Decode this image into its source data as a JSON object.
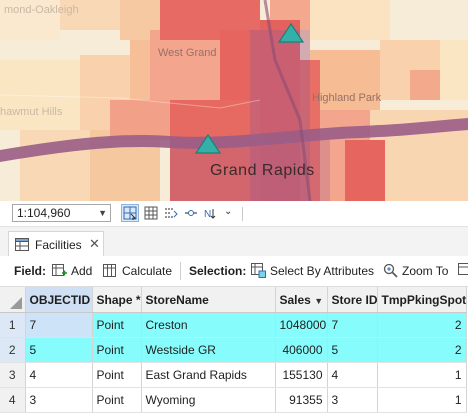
{
  "map": {
    "labels": {
      "top_left": "mond-Oakleigh",
      "west_grand": "West Grand",
      "highland_park": "Highland Park",
      "shawmut_hills": "hawmut Hills",
      "city": "Grand Rapids"
    },
    "scale": "1:104,960",
    "colors": {
      "dark": "#e86a64",
      "mid": "#f3a58d",
      "light": "#f9d2ad",
      "pale": "#fbe6c4",
      "point": "#33b0a8"
    }
  },
  "tab": {
    "label": "Facilities"
  },
  "ribbon": {
    "field_label": "Field:",
    "add": "Add",
    "calculate": "Calculate",
    "selection_label": "Selection:",
    "select_by_attributes": "Select By Attributes",
    "zoom_to": "Zoom To"
  },
  "table": {
    "columns": [
      "OBJECTID *",
      "Shape *",
      "StoreName",
      "Sales",
      "Store ID",
      "TmpPkingSpots"
    ],
    "rows": [
      {
        "num": "1",
        "objectid": "7",
        "shape": "Point",
        "store": "Creston",
        "sales": "1048000",
        "store_id": "7",
        "spots": "2",
        "selected": true
      },
      {
        "num": "2",
        "objectid": "5",
        "shape": "Point",
        "store": "Westside GR",
        "sales": "406000",
        "store_id": "5",
        "spots": "2",
        "selected": true
      },
      {
        "num": "3",
        "objectid": "4",
        "shape": "Point",
        "store": "East Grand Rapids",
        "sales": "155130",
        "store_id": "4",
        "spots": "1",
        "selected": false
      },
      {
        "num": "4",
        "objectid": "3",
        "shape": "Point",
        "store": "Wyoming",
        "sales": "91355",
        "store_id": "3",
        "spots": "1",
        "selected": false
      }
    ]
  }
}
